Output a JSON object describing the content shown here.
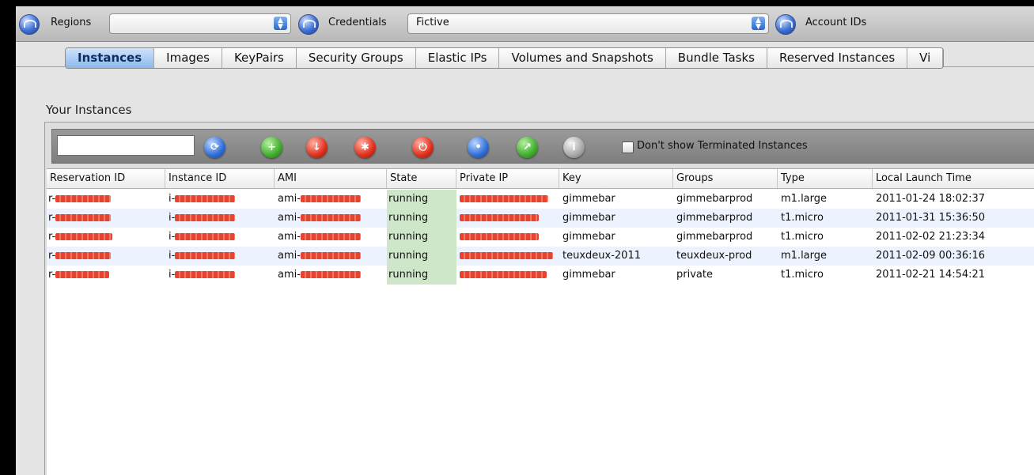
{
  "topbar": {
    "regions_label": "Regions",
    "regions_value": "",
    "credentials_label": "Credentials",
    "credentials_value": "Fictive",
    "account_ids_label": "Account IDs"
  },
  "tabs": [
    {
      "label": "Instances",
      "active": true
    },
    {
      "label": "Images"
    },
    {
      "label": "KeyPairs"
    },
    {
      "label": "Security Groups"
    },
    {
      "label": "Elastic IPs"
    },
    {
      "label": "Volumes and Snapshots"
    },
    {
      "label": "Bundle Tasks"
    },
    {
      "label": "Reserved Instances"
    },
    {
      "label": "Vi"
    }
  ],
  "section_title": "Your Instances",
  "toolbar": {
    "search_value": "",
    "terminated_checkbox_label": "Don't show Terminated Instances",
    "terminated_checked": false,
    "buttons": [
      "refresh-icon",
      "launch-icon",
      "terminate-icon",
      "reboot-icon",
      "stop-icon",
      "console-output-icon",
      "connect-icon",
      "info-icon"
    ]
  },
  "table": {
    "columns": [
      "Reservation ID",
      "Instance ID",
      "AMI",
      "State",
      "Private IP",
      "Key",
      "Groups",
      "Type",
      "Local Launch Time"
    ],
    "rows": [
      {
        "res_prefix": "r-",
        "inst_prefix": "i-",
        "ami_prefix": "ami-",
        "state": "running",
        "key": "gimmebar",
        "groups": "gimmebarprod",
        "type": "m1.large",
        "time": "2011-01-24 18:02:37"
      },
      {
        "res_prefix": "r-",
        "inst_prefix": "i-",
        "ami_prefix": "ami-",
        "state": "running",
        "key": "gimmebar",
        "groups": "gimmebarprod",
        "type": "t1.micro",
        "time": "2011-01-31 15:36:50"
      },
      {
        "res_prefix": "r-",
        "inst_prefix": "i-",
        "ami_prefix": "ami-",
        "state": "running",
        "key": "gimmebar",
        "groups": "gimmebarprod",
        "type": "t1.micro",
        "time": "2011-02-02 21:23:34"
      },
      {
        "res_prefix": "r-",
        "inst_prefix": "i-",
        "ami_prefix": "ami-",
        "state": "running",
        "key": "teuxdeux-2011",
        "groups": "teuxdeux-prod",
        "type": "m1.large",
        "time": "2011-02-09 00:36:16"
      },
      {
        "res_prefix": "r-",
        "inst_prefix": "i-",
        "ami_prefix": "ami-",
        "state": "running",
        "key": "gimmebar",
        "groups": "private",
        "type": "t1.micro",
        "time": "2011-02-21 14:54:21"
      }
    ]
  },
  "colors": {
    "redaction": "#e8432f",
    "state_running_bg": "#cfe7c9",
    "row_alt_bg": "#edf3fe",
    "active_tab": "#8cb8ec"
  }
}
